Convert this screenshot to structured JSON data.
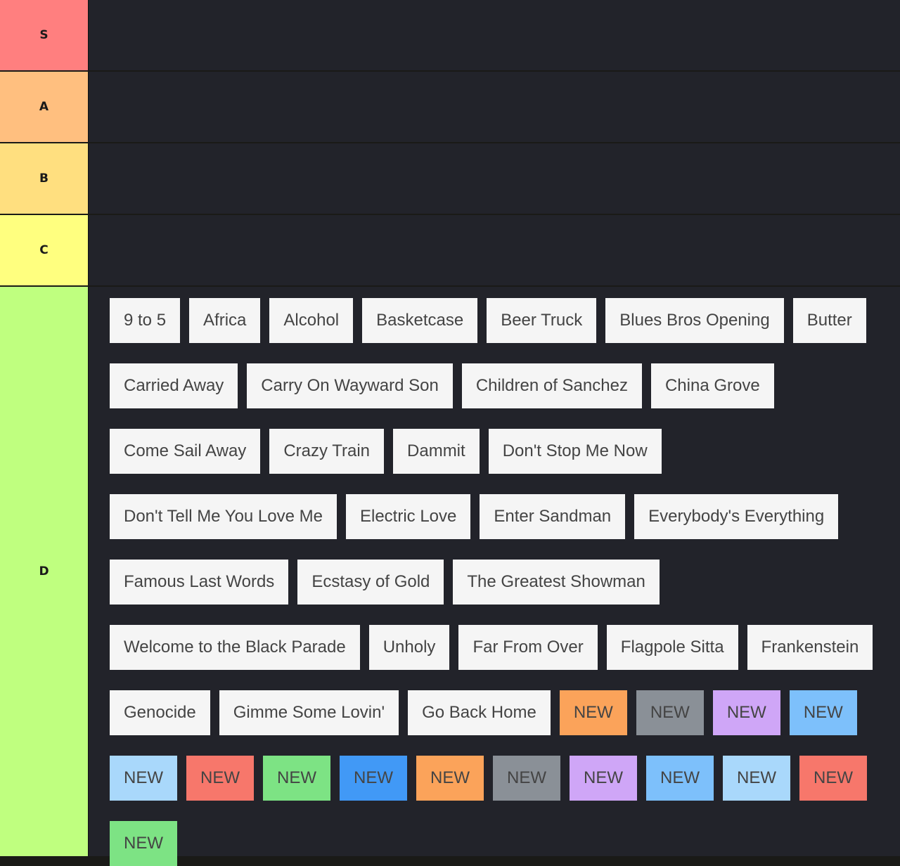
{
  "tiers": [
    {
      "label": "S",
      "color": "#ff7f7f",
      "items": []
    },
    {
      "label": "A",
      "color": "#ffbf7f",
      "items": []
    },
    {
      "label": "B",
      "color": "#ffdf7f",
      "items": []
    },
    {
      "label": "C",
      "color": "#ffff7f",
      "items": []
    },
    {
      "label": "D",
      "color": "#bfff7f",
      "items": [
        {
          "text": "9 to 5",
          "color": "#f5f5f5"
        },
        {
          "text": "Africa",
          "color": "#f5f5f5"
        },
        {
          "text": "Alcohol",
          "color": "#f5f5f5"
        },
        {
          "text": "Basketcase",
          "color": "#f5f5f5"
        },
        {
          "text": "Beer Truck",
          "color": "#f5f5f5"
        },
        {
          "text": "Blues Bros Opening",
          "color": "#f5f5f5"
        },
        {
          "text": "Butter",
          "color": "#f5f5f5"
        },
        {
          "text": "Carried Away",
          "color": "#f5f5f5"
        },
        {
          "text": "Carry On Wayward Son",
          "color": "#f5f5f5"
        },
        {
          "text": "Children of Sanchez",
          "color": "#f5f5f5"
        },
        {
          "text": "China Grove",
          "color": "#f5f5f5"
        },
        {
          "text": "Come Sail Away",
          "color": "#f5f5f5"
        },
        {
          "text": "Crazy Train",
          "color": "#f5f5f5"
        },
        {
          "text": "Dammit",
          "color": "#f5f5f5"
        },
        {
          "text": "Don't Stop Me Now",
          "color": "#f5f5f5"
        },
        {
          "text": "Don't Tell Me You Love Me",
          "color": "#f5f5f5"
        },
        {
          "text": "Electric Love",
          "color": "#f5f5f5"
        },
        {
          "text": "Enter Sandman",
          "color": "#f5f5f5"
        },
        {
          "text": "Everybody's Everything",
          "color": "#f5f5f5"
        },
        {
          "text": "Famous Last Words",
          "color": "#f5f5f5"
        },
        {
          "text": "Ecstasy of Gold",
          "color": "#f5f5f5"
        },
        {
          "text": "The Greatest Showman",
          "color": "#f5f5f5"
        },
        {
          "text": "Welcome to the Black Parade",
          "color": "#f5f5f5"
        },
        {
          "text": "Unholy",
          "color": "#f5f5f5"
        },
        {
          "text": "Far From Over",
          "color": "#f5f5f5"
        },
        {
          "text": "Flagpole Sitta",
          "color": "#f5f5f5"
        },
        {
          "text": "Frankenstein",
          "color": "#f5f5f5"
        },
        {
          "text": "Genocide",
          "color": "#f5f5f5"
        },
        {
          "text": "Gimme Some Lovin'",
          "color": "#f5f5f5"
        },
        {
          "text": "Go Back Home",
          "color": "#f5f5f5"
        },
        {
          "text": "NEW",
          "color": "#fba35a"
        },
        {
          "text": "NEW",
          "color": "#8a9097"
        },
        {
          "text": "NEW",
          "color": "#cfa6f7"
        },
        {
          "text": "NEW",
          "color": "#7dc0fb"
        },
        {
          "text": "NEW",
          "color": "#a9d8fb"
        },
        {
          "text": "NEW",
          "color": "#f7776b"
        },
        {
          "text": "NEW",
          "color": "#7de384"
        },
        {
          "text": "NEW",
          "color": "#4199f6"
        },
        {
          "text": "NEW",
          "color": "#fba35a"
        },
        {
          "text": "NEW",
          "color": "#8a9097"
        },
        {
          "text": "NEW",
          "color": "#cfa6f7"
        },
        {
          "text": "NEW",
          "color": "#7dc0fb"
        },
        {
          "text": "NEW",
          "color": "#a9d8fb"
        },
        {
          "text": "NEW",
          "color": "#f7776b"
        },
        {
          "text": "NEW",
          "color": "#7de384"
        }
      ]
    }
  ]
}
